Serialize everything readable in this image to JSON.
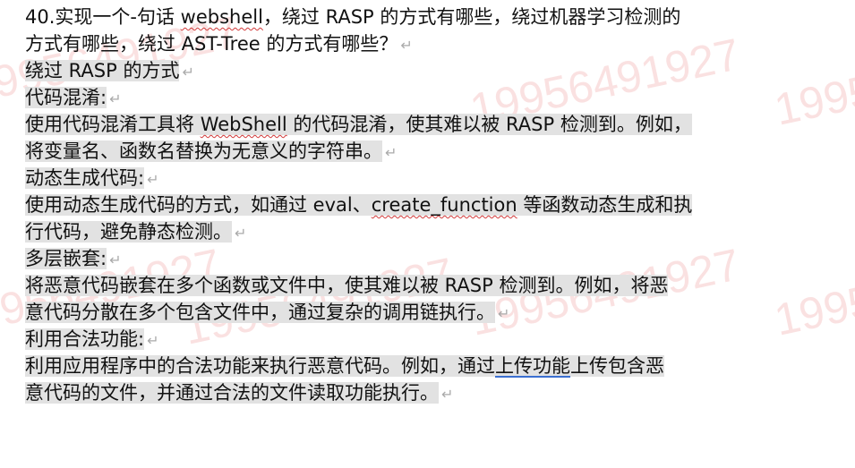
{
  "watermark": "19956491927",
  "paragraph_mark": "↵",
  "question": {
    "line1_a": "40.实现一个-句话 ",
    "line1_b": "webshell",
    "line1_c": "，绕过 RASP 的方式有哪些，绕过机器学习检测的",
    "line2": "方式有哪些，绕过 AST-Tree 的方式有哪些？"
  },
  "section_title": "绕过 RASP 的方式",
  "items": [
    {
      "heading": "代码混淆:",
      "line1_a": "使用代码混淆工具将 ",
      "line1_b": "WebShell",
      "line1_c": " 的代码混淆，使其难以被 RASP 检测到。例如，",
      "line2": "将变量名、函数名替换为无意义的字符串。"
    },
    {
      "heading": "动态生成代码:",
      "line1_a": "使用动态生成代码的方式，如通过 eval、",
      "line1_b": "create_function",
      "line1_c": " 等函数动态生成和执",
      "line2": "行代码，避免静态检测。"
    },
    {
      "heading": "多层嵌套:",
      "line1_a": "将恶意代码嵌套在多个函数或文件中，使其难以被 RASP 检测到。例如，将恶",
      "line1_b": "",
      "line1_c": "",
      "line2": "意代码分散在多个包含文件中，通过复杂的调用链执行。"
    },
    {
      "heading": "利用合法功能:",
      "line1_a": "利用应用程序中的合法功能来执行恶意代码。例如，通过",
      "line1_b": "上传功能",
      "line1_c": "上传包含恶",
      "line2": "意代码的文件，并通过合法的文件读取功能执行。"
    }
  ]
}
